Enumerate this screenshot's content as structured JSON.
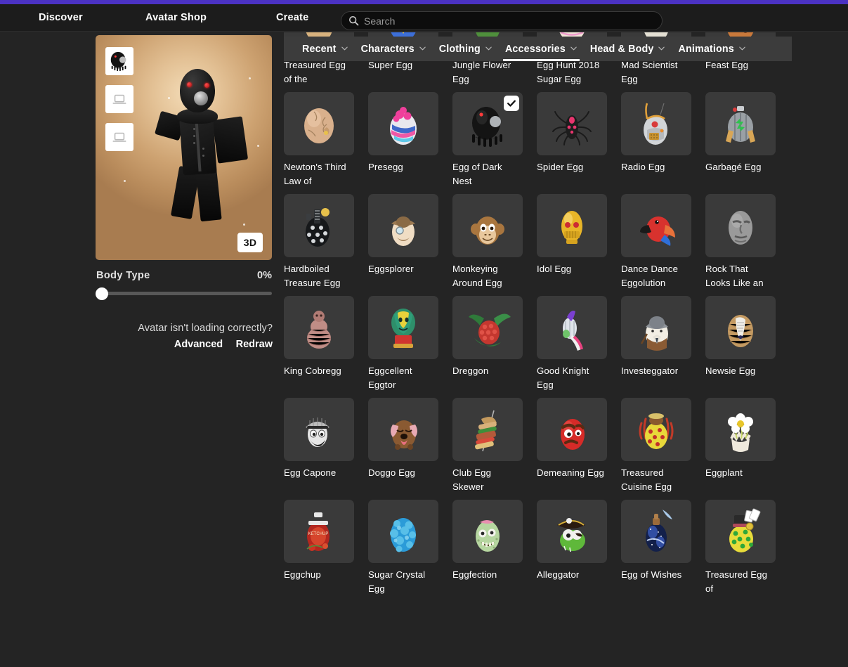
{
  "theme": {
    "accent": "#4b32c3",
    "nav_bg": "#1c1c1c",
    "page_bg": "#242424",
    "card_bg": "#3a3a3a",
    "tabbar_bg": "#3c3c3c",
    "text": "#ffffff"
  },
  "topnav": {
    "links": [
      {
        "label": "Discover",
        "name": "nav-discover"
      },
      {
        "label": "Avatar Shop",
        "name": "nav-avatar-shop"
      },
      {
        "label": "Create",
        "name": "nav-create"
      }
    ],
    "search": {
      "placeholder": "Search",
      "value": "",
      "icon": "search-icon"
    }
  },
  "avatar_panel": {
    "thumbnails": [
      {
        "name": "avatar-thumbnail-selected",
        "icon": "egg-of-dark-nest-thumb"
      },
      {
        "name": "avatar-thumbnail-placeholder-1",
        "icon": "image-placeholder-icon"
      },
      {
        "name": "avatar-thumbnail-placeholder-2",
        "icon": "image-placeholder-icon"
      }
    ],
    "view_toggle": {
      "label": "3D",
      "name": "view-3d-toggle"
    },
    "body_type": {
      "label": "Body Type",
      "value": "0%",
      "percent": 0
    },
    "loading_question": "Avatar isn't loading correctly?",
    "actions": [
      {
        "label": "Advanced",
        "name": "advanced-link"
      },
      {
        "label": "Redraw",
        "name": "redraw-link"
      }
    ]
  },
  "tabs": [
    {
      "label": "Recent",
      "active": false
    },
    {
      "label": "Characters",
      "active": false
    },
    {
      "label": "Clothing",
      "active": false
    },
    {
      "label": "Accessories",
      "active": true
    },
    {
      "label": "Head & Body",
      "active": false
    },
    {
      "label": "Animations",
      "active": false
    }
  ],
  "items": [
    {
      "label": "Treasured Egg of the",
      "art": "treasured-egg",
      "selected": false
    },
    {
      "label": "Super Egg",
      "art": "super-egg",
      "selected": false
    },
    {
      "label": "Jungle Flower Egg",
      "art": "jungle-flower-egg",
      "selected": false
    },
    {
      "label": "Egg Hunt 2018 Sugar Egg",
      "art": "sugar-egg",
      "selected": false
    },
    {
      "label": "Mad Scientist Egg",
      "art": "mad-scientist-egg",
      "selected": false
    },
    {
      "label": "Feast Egg",
      "art": "feast-egg",
      "selected": false
    },
    {
      "label": "Newton's Third Law of",
      "art": "newtons-egg",
      "selected": false
    },
    {
      "label": "Presegg",
      "art": "presegg",
      "selected": false
    },
    {
      "label": "Egg of Dark Nest",
      "art": "egg-of-dark-nest",
      "selected": true
    },
    {
      "label": "Spider Egg",
      "art": "spider-egg",
      "selected": false
    },
    {
      "label": "Radio Egg",
      "art": "radio-egg",
      "selected": false
    },
    {
      "label": "Garbagé Egg",
      "art": "garbage-egg",
      "selected": false
    },
    {
      "label": "Hardboiled Treasure Egg",
      "art": "hardboiled-treasure-egg",
      "selected": false
    },
    {
      "label": "Eggsplorer",
      "art": "eggsplorer",
      "selected": false
    },
    {
      "label": "Monkeying Around Egg",
      "art": "monkeying-around-egg",
      "selected": false
    },
    {
      "label": "Idol Egg",
      "art": "idol-egg",
      "selected": false
    },
    {
      "label": "Dance Dance Eggolution",
      "art": "dance-dance-eggolution",
      "selected": false
    },
    {
      "label": "Rock That Looks Like an",
      "art": "rock-egg",
      "selected": false
    },
    {
      "label": "King Cobregg",
      "art": "king-cobregg",
      "selected": false
    },
    {
      "label": "Eggcellent Eggtor",
      "art": "eggcellent-eggtor",
      "selected": false
    },
    {
      "label": "Dreggon",
      "art": "dreggon",
      "selected": false
    },
    {
      "label": "Good Knight Egg",
      "art": "good-knight-egg",
      "selected": false
    },
    {
      "label": "Investeggator",
      "art": "investeggator",
      "selected": false
    },
    {
      "label": "Newsie Egg",
      "art": "newsie-egg",
      "selected": false
    },
    {
      "label": "Egg Capone",
      "art": "egg-capone",
      "selected": false
    },
    {
      "label": "Doggo Egg",
      "art": "doggo-egg",
      "selected": false
    },
    {
      "label": "Club Egg Skewer",
      "art": "club-egg-skewer",
      "selected": false
    },
    {
      "label": "Demeaning Egg",
      "art": "demeaning-egg",
      "selected": false
    },
    {
      "label": "Treasured Cuisine Egg",
      "art": "treasured-cuisine-egg",
      "selected": false
    },
    {
      "label": "Eggplant",
      "art": "eggplant",
      "selected": false
    },
    {
      "label": "Eggchup",
      "art": "eggchup",
      "selected": false
    },
    {
      "label": "Sugar Crystal Egg",
      "art": "sugar-crystal-egg",
      "selected": false
    },
    {
      "label": "Eggfection",
      "art": "eggfection",
      "selected": false
    },
    {
      "label": "Alleggator",
      "art": "alleggator",
      "selected": false
    },
    {
      "label": "Egg of Wishes",
      "art": "egg-of-wishes",
      "selected": false
    },
    {
      "label": "Treasured Egg of",
      "art": "treasured-egg-of",
      "selected": false
    }
  ]
}
